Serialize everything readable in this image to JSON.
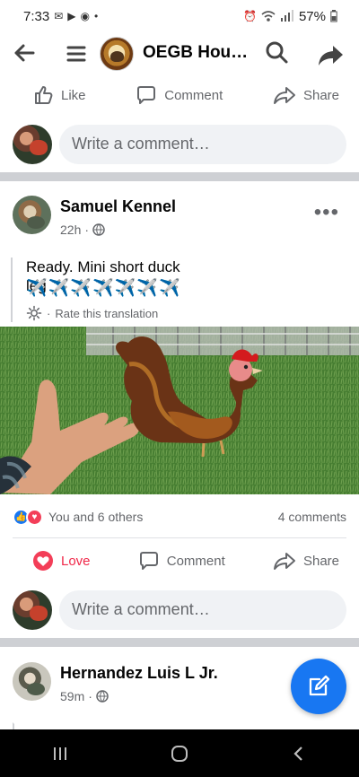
{
  "status": {
    "time": "7:33",
    "battery": "57%",
    "left_icons": [
      "mail-icon",
      "youtube-icon",
      "reddit-icon",
      "notification-dot"
    ],
    "right_icons": [
      "alarm-icon",
      "wifi-icon",
      "signal-icon",
      "battery-icon"
    ]
  },
  "header": {
    "title": "OEGB Houst…",
    "icons": [
      "back-arrow-icon",
      "menu-icon",
      "search-icon",
      "share-icon"
    ]
  },
  "previous_post": {
    "actions": {
      "like": "Like",
      "comment": "Comment",
      "share": "Share"
    },
    "comment_placeholder": "Write a comment…"
  },
  "post": {
    "author": "Samuel Kennel",
    "time": "22h",
    "text": "Ready. Mini short duck leg",
    "emoji": [
      "✈️",
      "✈️",
      "✈️",
      "✈️",
      "✈️",
      "✈️",
      "✈️"
    ],
    "translation_action": "Rate this translation",
    "reaction_summary": "You and 6 others",
    "comment_count": "4 comments",
    "actions": {
      "love": "Love",
      "comment": "Comment",
      "share": "Share"
    },
    "comment_placeholder": "Write a comment…"
  },
  "next_post": {
    "author": "Hernandez Luis L Jr.",
    "time": "59m"
  },
  "colors": {
    "brand_blue": "#1877f2",
    "love_red": "#f02849",
    "muted_text": "#65676b",
    "divider": "#ced0d4"
  }
}
